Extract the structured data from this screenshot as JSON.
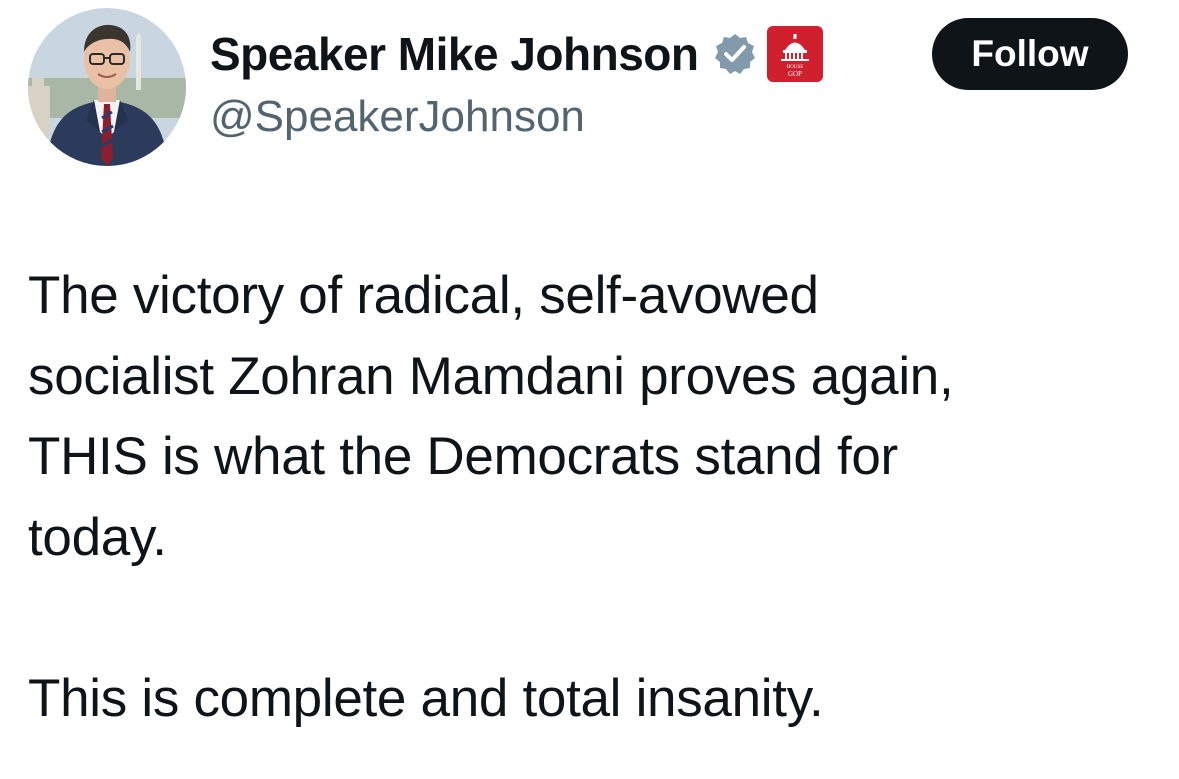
{
  "author": {
    "display_name": "Speaker Mike Johnson",
    "handle": "@SpeakerJohnson",
    "verified_icon": "verified-badge-icon",
    "affiliation_icon": "house-gop-badge-icon",
    "affiliation_badge_text": "HOUSE GOP",
    "avatar_icon": "profile-avatar"
  },
  "follow_button": {
    "label": "Follow"
  },
  "tweet": {
    "lines": [
      "The victory of radical, self-avowed",
      "socialist Zohran Mamdani proves again,",
      "THIS is what the Democrats stand for",
      "today."
    ],
    "closing": "This is complete and total insanity."
  },
  "colors": {
    "text": "#0f1419",
    "secondary": "#536471",
    "verified": "#829aab",
    "affiliation": "#d0202e",
    "button_bg": "#0f1419",
    "button_text": "#ffffff"
  }
}
